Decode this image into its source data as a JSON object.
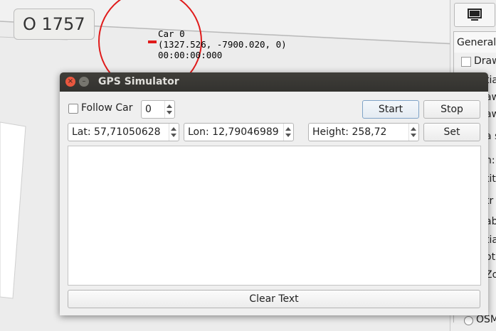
{
  "map": {
    "label": "O 1757",
    "car_name": "Car 0",
    "car_position": "(1327.526, -7900.020, 0)",
    "car_time": "00:00:00:000",
    "colors": {
      "road": "#ffffff",
      "circle": "#e01b1b"
    }
  },
  "side_panel": {
    "icon": "monitor-icon",
    "tab": "General",
    "rows": [
      "Draw",
      "tia",
      "aw",
      "aw",
      "a s",
      "h:",
      "tit",
      "tr",
      "ab",
      "tia",
      "ot",
      "Zo"
    ],
    "radio_label": "OSM"
  },
  "gps": {
    "title": "GPS Simulator",
    "follow_car_label": "Follow Car",
    "follow_car_checked": false,
    "car_index": "0",
    "start_label": "Start",
    "stop_label": "Stop",
    "lat": "Lat: 57,71050628",
    "lon": "Lon: 12,79046989",
    "height": "Height: 258,72",
    "set_label": "Set",
    "log_text": "",
    "clear_label": "Clear Text",
    "window_buttons": {
      "close": "×",
      "minimize": "–"
    }
  }
}
